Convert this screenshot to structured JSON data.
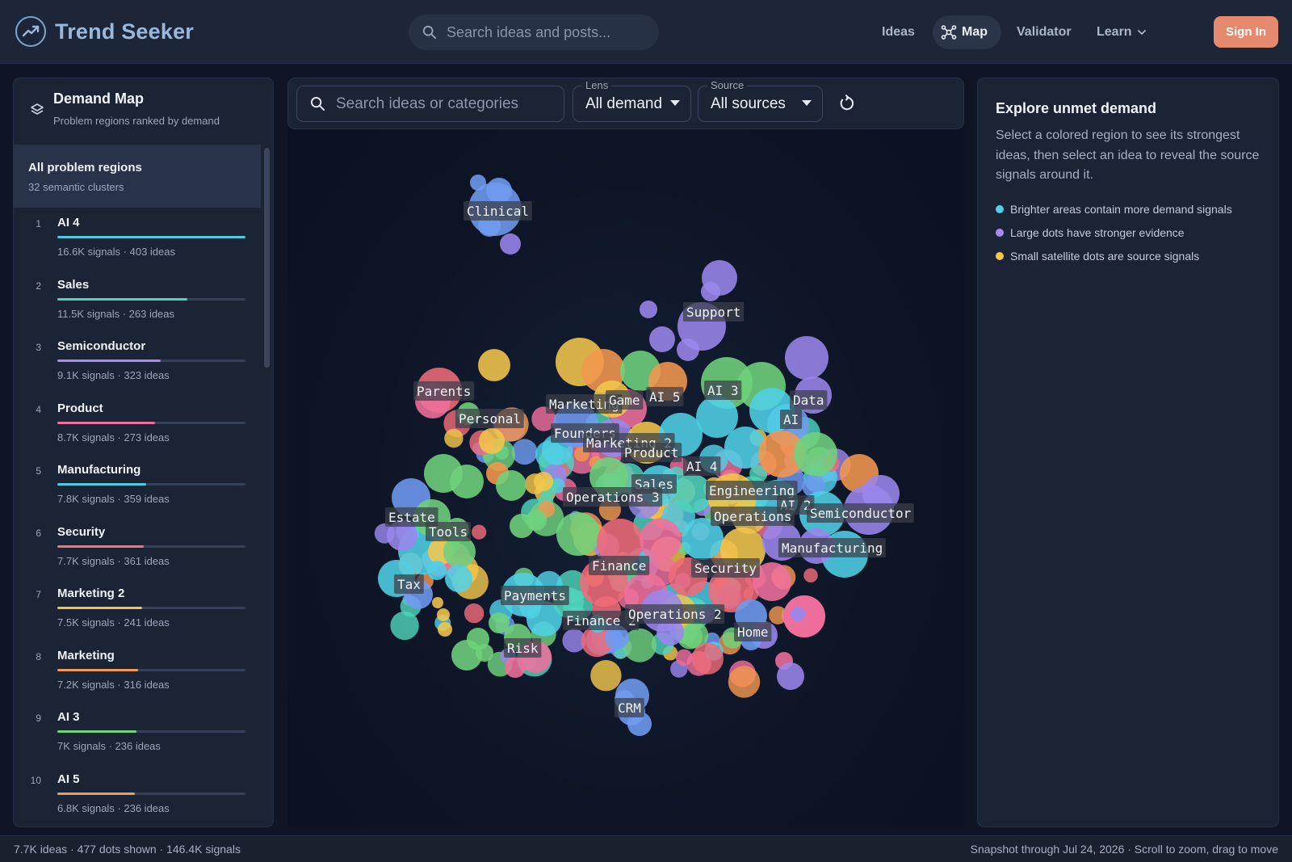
{
  "app": {
    "name": "Trend Seeker"
  },
  "header": {
    "search_placeholder": "Search ideas and posts...",
    "nav": {
      "ideas": "Ideas",
      "map": "Map",
      "validator": "Validator",
      "learn": "Learn"
    },
    "signin": "Sign In"
  },
  "left_panel": {
    "title": "Demand Map",
    "subtitle": "Problem regions ranked by demand",
    "all": {
      "title": "All problem regions",
      "subtitle": "32 semantic clusters"
    },
    "items": [
      {
        "rank": "1",
        "name": "AI 4",
        "meta": "16.6K signals · 403 ideas",
        "share": 1.0,
        "color": "#4ec9e0"
      },
      {
        "rank": "2",
        "name": "Sales",
        "meta": "11.5K signals · 263 ideas",
        "share": 0.69,
        "color": "#4fd3bb"
      },
      {
        "rank": "3",
        "name": "Semiconductor",
        "meta": "9.1K signals · 323 ideas",
        "share": 0.55,
        "color": "#a58df0"
      },
      {
        "rank": "4",
        "name": "Product",
        "meta": "8.7K signals · 273 ideas",
        "share": 0.52,
        "color": "#ef6fa2"
      },
      {
        "rank": "5",
        "name": "Manufacturing",
        "meta": "7.8K signals · 359 ideas",
        "share": 0.47,
        "color": "#4ec9e0"
      },
      {
        "rank": "6",
        "name": "Security",
        "meta": "7.7K signals · 361 ideas",
        "share": 0.46,
        "color": "#f0737d"
      },
      {
        "rank": "7",
        "name": "Marketing 2",
        "meta": "7.5K signals · 241 ideas",
        "share": 0.45,
        "color": "#f2c14f"
      },
      {
        "rank": "8",
        "name": "Marketing",
        "meta": "7.2K signals · 316 ideas",
        "share": 0.43,
        "color": "#f29a4f"
      },
      {
        "rank": "9",
        "name": "AI 3",
        "meta": "7K signals · 236 ideas",
        "share": 0.42,
        "color": "#6fd47a"
      },
      {
        "rank": "10",
        "name": "AI 5",
        "meta": "6.8K signals · 236 ideas",
        "share": 0.41,
        "color": "#f29a4f"
      }
    ]
  },
  "toolbar": {
    "search_placeholder": "Search ideas or categories",
    "lens": {
      "label": "Lens",
      "value": "All demand"
    },
    "source": {
      "label": "Source",
      "value": "All sources"
    }
  },
  "map": {
    "labels": [
      "Clinical",
      "Support",
      "Parents",
      "Personal",
      "Marketing",
      "Game",
      "AI 5",
      "AI 3",
      "Data",
      "AI",
      "Founders",
      "Marketing 2",
      "Product",
      "AI 4",
      "Sales",
      "Operations 3",
      "Engineering",
      "AI 2",
      "Semiconductor",
      "Operations",
      "Estate",
      "Tools",
      "Manufacturing",
      "Finance",
      "Security",
      "Tax",
      "Payments",
      "Finance 2",
      "Operations 2",
      "Home",
      "Risk",
      "CRM"
    ],
    "palette": {
      "blue": "#6f9bf0",
      "violet": "#9a86ec",
      "cyan": "#4fd0e6",
      "green": "#6fd27c",
      "yellow": "#f3c64b",
      "orange": "#f2974f",
      "pink": "#ee6f9c",
      "red": "#ef6b79",
      "teal": "#4fd3b9"
    }
  },
  "right_panel": {
    "title": "Explore unmet demand",
    "description": "Select a colored region to see its strongest ideas, then select an idea to reveal the source signals around it.",
    "legend": [
      {
        "text": "Brighter areas contain more demand signals",
        "color": "#4fd0e6"
      },
      {
        "text": "Large dots have stronger evidence",
        "color": "#a58df0"
      },
      {
        "text": "Small satellite dots are source signals",
        "color": "#f3c64b"
      }
    ]
  },
  "footer": {
    "left": "7.7K ideas · 477 dots shown · 146.4K signals",
    "right": "Snapshot through Jul 24, 2026 · Scroll to zoom, drag to move"
  }
}
